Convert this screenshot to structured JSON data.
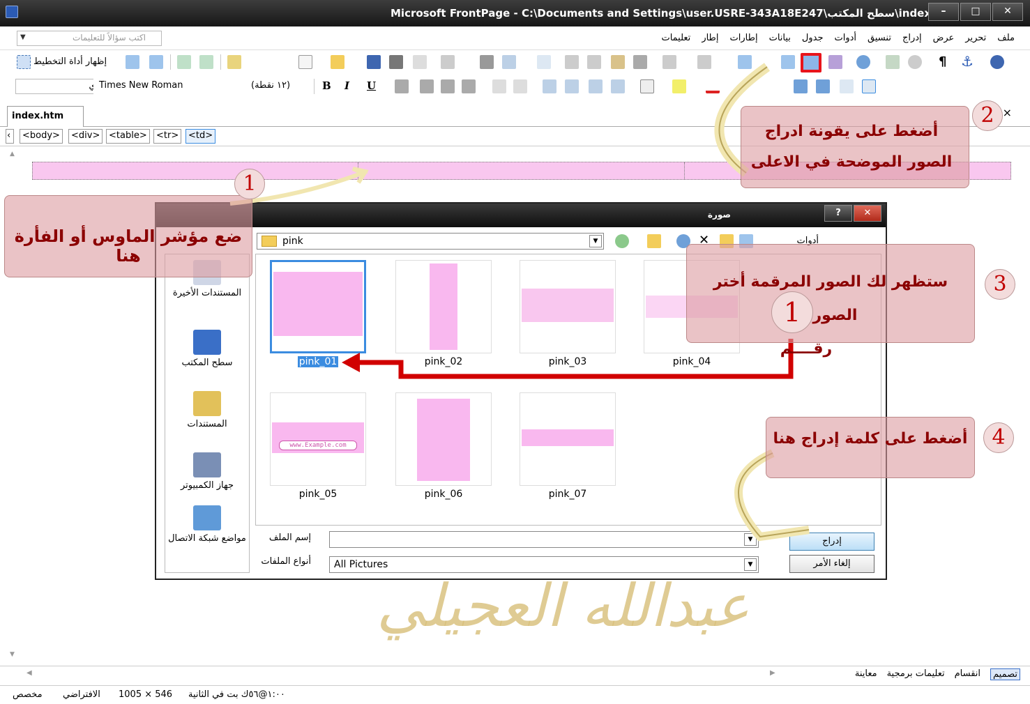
{
  "window": {
    "title": "Microsoft FrontPage - C:\\Documents and Settings\\user.USRE-343A18E247\\سطح المكتب\\index.htm"
  },
  "ask_box": {
    "placeholder": "اكتب سؤالاً للتعليمات"
  },
  "menu": [
    "ملف",
    "تحرير",
    "عرض",
    "إدراج",
    "تنسيق",
    "أدوات",
    "جدول",
    "بيانات",
    "إطارات",
    "إطار",
    "تعليمات"
  ],
  "toolbar": {
    "show_layout_tool": "إظهار أداة التخطيط",
    "style": "عادي",
    "font": "Times New Roman",
    "size": "(١٢ نقطة)",
    "bold": "B",
    "italic": "I",
    "underline": "U"
  },
  "tabs": {
    "file": "index.htm"
  },
  "tag_path": [
    "<body>",
    "<div>",
    "<table>",
    "<tr>",
    "<td>"
  ],
  "dialog": {
    "title": "صورة",
    "look_in": "pink",
    "tools": "أدوات",
    "places": [
      "المستندات الأخيرة",
      "سطح المكتب",
      "المستندات",
      "جهاز الكمبيوتر",
      "مواضع شبكة الاتصال"
    ],
    "files": [
      "pink_01",
      "pink_02",
      "pink_03",
      "pink_04",
      "pink_05",
      "pink_06",
      "pink_07"
    ],
    "filename_label": "إسم الملف",
    "filename_value": "",
    "filetype_label": "أنواع الملفات",
    "filetype_value": "All Pictures",
    "insert_button": "إدراج",
    "cancel_button": "إلغاء الأمر",
    "thumb_texts": {
      "pink_05": "www.Example.com"
    }
  },
  "callouts": {
    "c1": "ضع مؤشر الماوس أو الفأرة هنا",
    "c2": "أضغط على يقونة ادراج الصور الموضحة في الاعلى",
    "c3_line1": "ستظهر لك الصور المرقمة أختر الصورة",
    "c3_line2": "رقــــم",
    "c4": "أضغط على كلمة إدراج هنا",
    "n1": "1",
    "n2": "2",
    "n3": "3",
    "n4": "4",
    "n_inner": "1"
  },
  "view_tabs": [
    "تصميم",
    "انقسام",
    "تعليمات برمجية",
    "معاينة"
  ],
  "status": {
    "speed": "١:٠٠@٥٦ك بت في الثانية",
    "size": "1005 × 546",
    "mode": "الافتراضي",
    "custom": "مخصص"
  },
  "signature": "عبدالله العجيلي",
  "colors": {
    "accent_red": "#e8141b",
    "pink": "#f9c7ef",
    "callout": "#dc9ba0"
  }
}
